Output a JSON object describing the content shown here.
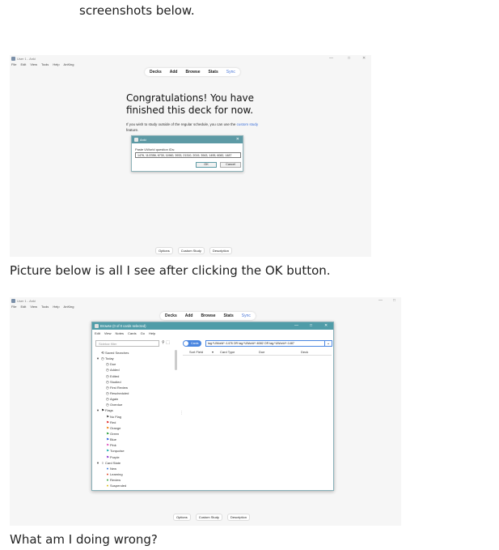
{
  "post": {
    "intro": "screenshots below.",
    "caption_after_ok": "Picture below is all I see after clicking the  OK button.",
    "question": "What am I doing wrong?"
  },
  "window": {
    "title": "User 1 - Anki",
    "menu": [
      "File",
      "Edit",
      "View",
      "Tools",
      "Help",
      "AnKing"
    ],
    "controls": [
      "—",
      "□",
      "✕"
    ]
  },
  "toolbar": {
    "items": [
      "Decks",
      "Add",
      "Browse",
      "Stats",
      "Sync"
    ]
  },
  "congrats": {
    "heading": "Congratulations! You have finished this deck for now.",
    "body_prefix": "If you wish to study outside of the regular schedule, you can use the ",
    "link": "custom study",
    "body_suffix": " feature."
  },
  "dialog": {
    "title": "Anki",
    "label": "Paste UWorld question IDs:",
    "value": "1476, 11/2356, 6730, 11960, 3933, 21310, 2019, 3943, 1495, 6082, 1487",
    "ok": "OK",
    "cancel": "Cancel"
  },
  "bottom": {
    "options": "Options",
    "custom_study": "Custom Study",
    "description": "Description"
  },
  "browse": {
    "title": "Browse (0 of 0 cards selected)",
    "menu": [
      "Edit",
      "View",
      "Notes",
      "Cards",
      "Go",
      "Help"
    ],
    "filter_placeholder": "Sidebar filter",
    "toggle": "Cards",
    "search": "tag:*UWorld*::1476 OR tag:*UWorld*::6082 OR tag:*UWorld*::1487",
    "columns": [
      "Sort Field",
      "Card Type",
      "Due",
      "Deck"
    ],
    "sidebar": [
      {
        "icon": "⟲",
        "label": "Saved Searches",
        "indent": 0
      },
      {
        "icon": "◷",
        "label": "Today",
        "indent": 0,
        "caret": "▾"
      },
      {
        "icon": "◷",
        "label": "Due",
        "indent": 1
      },
      {
        "icon": "◷",
        "label": "Added",
        "indent": 1
      },
      {
        "icon": "◷",
        "label": "Edited",
        "indent": 1
      },
      {
        "icon": "◷",
        "label": "Studied",
        "indent": 1
      },
      {
        "icon": "◷",
        "label": "First Review",
        "indent": 1
      },
      {
        "icon": "◷",
        "label": "Rescheduled",
        "indent": 1
      },
      {
        "icon": "◷",
        "label": "Again",
        "indent": 1
      },
      {
        "icon": "◷",
        "label": "Overdue",
        "indent": 1
      },
      {
        "icon": "⚑",
        "label": "Flags",
        "indent": 0,
        "caret": "▾"
      },
      {
        "icon": "⚑",
        "label": "No Flag",
        "indent": 1,
        "color": "#555555"
      },
      {
        "icon": "⚑",
        "label": "Red",
        "indent": 1,
        "color": "#e03030"
      },
      {
        "icon": "⚑",
        "label": "Orange",
        "indent": 1,
        "color": "#f08a20"
      },
      {
        "icon": "⚑",
        "label": "Green",
        "indent": 1,
        "color": "#30a040"
      },
      {
        "icon": "⚑",
        "label": "Blue",
        "indent": 1,
        "color": "#3060e0"
      },
      {
        "icon": "⚑",
        "label": "Pink",
        "indent": 1,
        "color": "#e060c0"
      },
      {
        "icon": "⚑",
        "label": "Turquoise",
        "indent": 1,
        "color": "#20b0b0"
      },
      {
        "icon": "⚑",
        "label": "Purple",
        "indent": 1,
        "color": "#9040d0"
      },
      {
        "icon": "○",
        "label": "Card State",
        "indent": 0,
        "caret": "▾"
      },
      {
        "icon": "●",
        "label": "New",
        "indent": 1,
        "color": "#3a7ae0"
      },
      {
        "icon": "●",
        "label": "Learning",
        "indent": 1,
        "color": "#e05030"
      },
      {
        "icon": "●",
        "label": "Review",
        "indent": 1,
        "color": "#30a040"
      },
      {
        "icon": "●",
        "label": "Suspended",
        "indent": 1,
        "color": "#e0c020"
      }
    ]
  }
}
